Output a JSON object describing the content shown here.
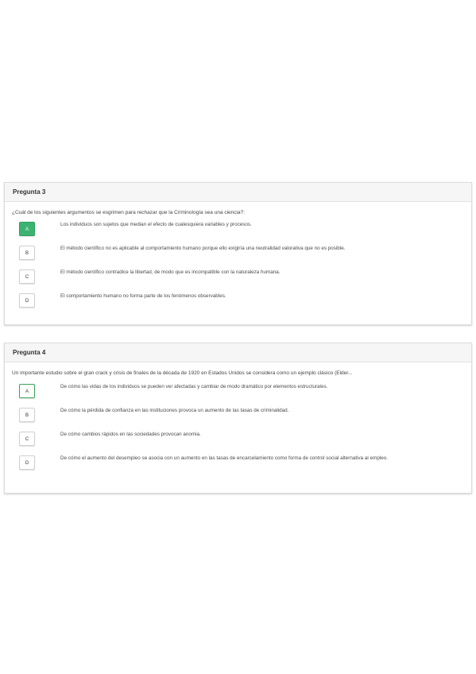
{
  "questions": [
    {
      "header": "Pregunta 3",
      "prompt": "¿Cuál de los siguientes argumentos se esgrimen para rechazar que la Criminología sea una ciencia?:",
      "options": [
        {
          "letter": "A",
          "text": "Los individuos son sujetos que median el efecto de cualesquiera variables y procesos."
        },
        {
          "letter": "B",
          "text": "El método científico no es aplicable al comportamiento humano porque ello exigiría una neutralidad valorativa que no es posible."
        },
        {
          "letter": "C",
          "text": "El método científico contradice la libertad, de modo que es incompatible con la naturaleza humana."
        },
        {
          "letter": "D",
          "text": "El comportamiento humano no forma parte de los fenómenos observables."
        }
      ],
      "selected": "A"
    },
    {
      "header": "Pregunta 4",
      "prompt": "Un importante estudio sobre el gran crack y crisis de finales de la década de 1920 en Estados Unidos se considera como un ejemplo clásico (Elder...",
      "options": [
        {
          "letter": "A",
          "text": "De cómo las vidas de los individuos se pueden ver afectadas y cambiar de modo dramático por elementos estructurales."
        },
        {
          "letter": "B",
          "text": "De cómo la pérdida de confianza en las instituciones provoca un aumento de las tasas de criminalidad."
        },
        {
          "letter": "C",
          "text": "De cómo cambios rápidos en las sociedades provocan anomia."
        },
        {
          "letter": "D",
          "text": "De cómo el aumento del desempleo se asocia con un aumento en las tasas de encarcelamiento como forma de control social alternativa al empleo."
        }
      ],
      "selected": "A"
    }
  ],
  "colors": {
    "accent": "#3cb371",
    "accent_border": "#2f9e60"
  }
}
